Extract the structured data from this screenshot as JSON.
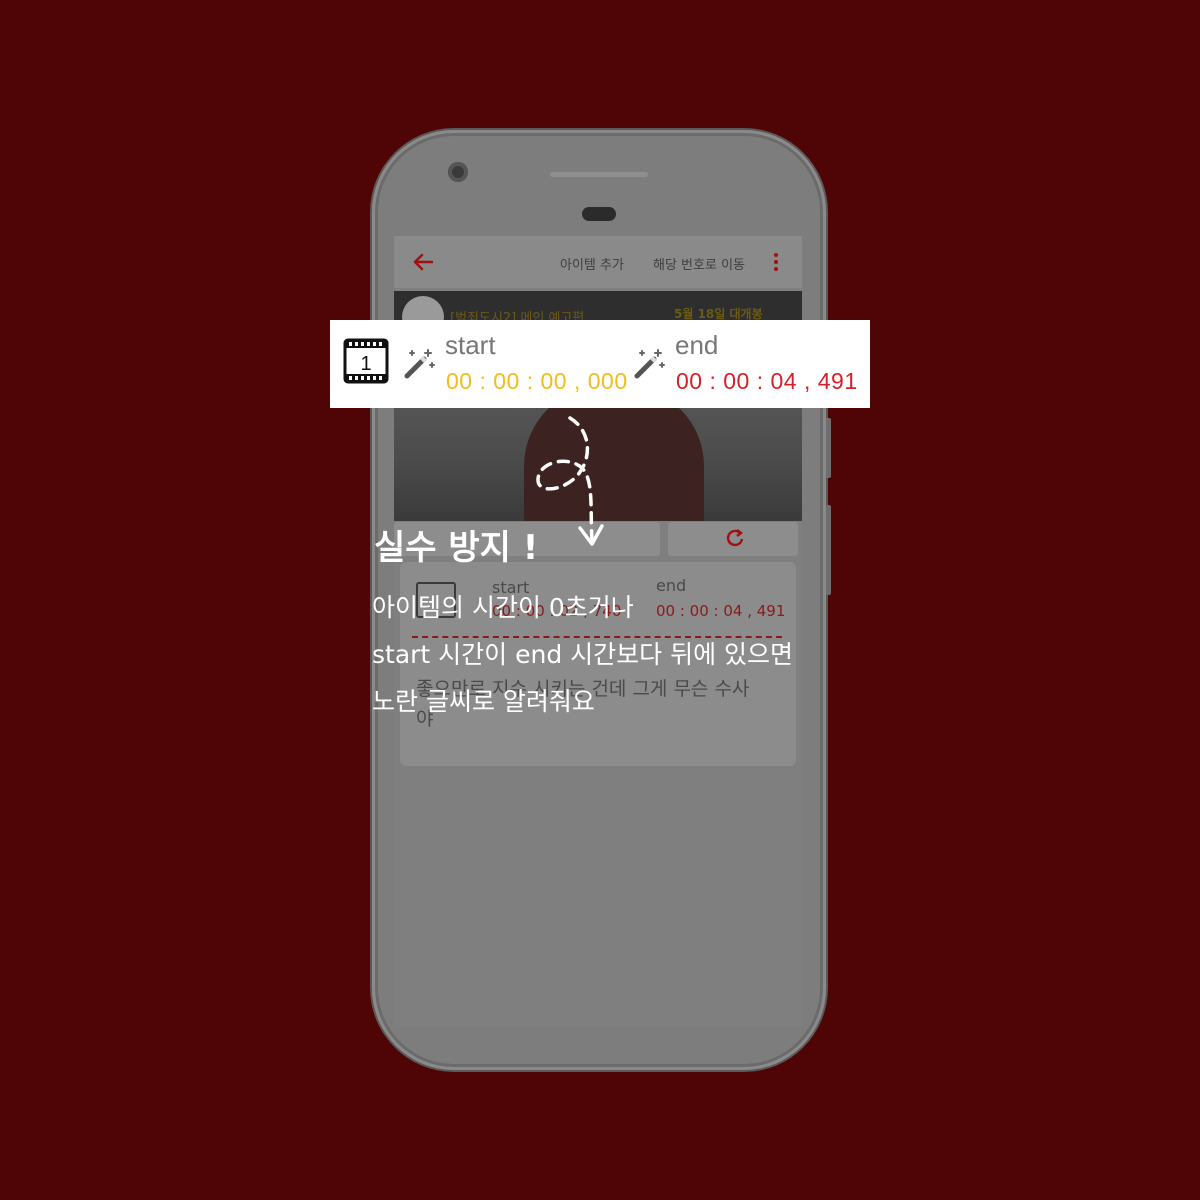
{
  "appbar": {
    "back_icon": "arrow-left-icon",
    "add_item_label": "아이템 추가",
    "goto_number_label": "해당 번호로 이동",
    "more_icon": "more-vertical-icon"
  },
  "video": {
    "title": "[범죄도시2] 메인 예고편",
    "tag": "5월 18일 대개봉"
  },
  "highlight": {
    "clapper_number": "1",
    "start_label": "start",
    "start_time": "00 : 00 : 00 , 000",
    "end_label": "end",
    "end_time": "00 : 00 : 04 , 491",
    "wand_icon": "magic-wand-icon",
    "colors": {
      "start_time": "#f0bd1d",
      "end_time": "#d6202a"
    }
  },
  "card": {
    "start_label": "start",
    "start_time": "00 : 00 : 02 , 740",
    "end_label": "end",
    "end_time": "00 : 00 : 04 , 491",
    "text_line1": "좋으만로 지수 시키는 건데 그게 무슨 수사",
    "text_line2": "야"
  },
  "callout": {
    "title": "실수 방지 !",
    "line1": "아이템의 시간이 0초거나",
    "line2": "start 시간이 end 시간보다 뒤에 있으면",
    "line3": "노란 글씨로 알려줘요"
  },
  "colors": {
    "background": "#4f0406",
    "accent": "#a0100f"
  }
}
